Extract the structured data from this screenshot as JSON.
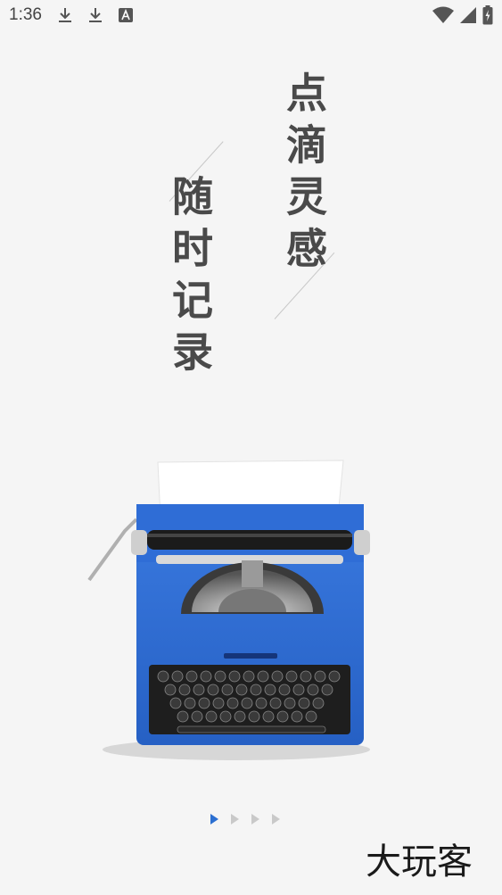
{
  "status_bar": {
    "time": "1:36",
    "icons": [
      "download-icon",
      "download-icon",
      "text-a-icon"
    ],
    "right_icons": [
      "wifi-icon",
      "signal-icon",
      "battery-charging-icon"
    ]
  },
  "slogans": {
    "line1": "点滴灵感",
    "line2": "随时记录"
  },
  "pager": {
    "count": 4,
    "active_index": 0,
    "active_color": "#2b6fd1",
    "inactive_color": "#c9c9c9"
  },
  "watermark": {
    "text": "大玩客"
  },
  "colors": {
    "background": "#f5f5f5",
    "typewriter_blue": "#2f6fd6"
  }
}
